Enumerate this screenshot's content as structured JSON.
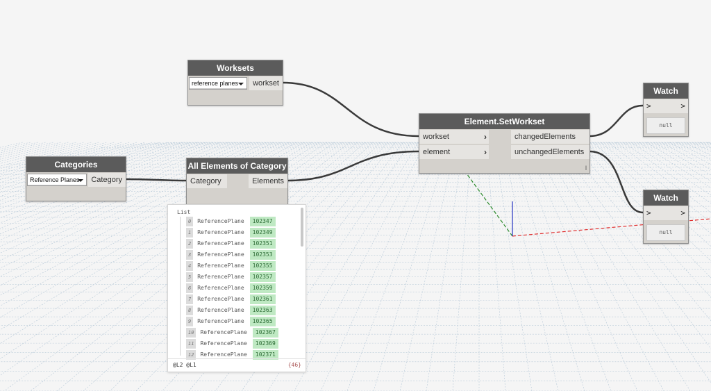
{
  "nodes": {
    "worksets": {
      "title": "Worksets",
      "dropdown_value": "reference planes",
      "output": "workset"
    },
    "categories": {
      "title": "Categories",
      "dropdown_value": "Reference Planes",
      "output": "Category"
    },
    "all_elements": {
      "title": "All Elements of Category",
      "input": "Category",
      "output": "Elements"
    },
    "set_workset": {
      "title": "Element.SetWorkset",
      "inputs": [
        "workset",
        "element"
      ],
      "outputs": [
        "changedElements",
        "unchangedElements"
      ],
      "lacing_mark": "l"
    },
    "watch1": {
      "title": "Watch",
      "in_arrow": ">",
      "out_arrow": ">",
      "value": "null"
    },
    "watch2": {
      "title": "Watch",
      "in_arrow": ">",
      "out_arrow": ">",
      "value": "null"
    }
  },
  "preview": {
    "title": "List",
    "rows": [
      {
        "index": "0",
        "type": "ReferencePlane",
        "id": "102347"
      },
      {
        "index": "1",
        "type": "ReferencePlane",
        "id": "102349"
      },
      {
        "index": "2",
        "type": "ReferencePlane",
        "id": "102351"
      },
      {
        "index": "3",
        "type": "ReferencePlane",
        "id": "102353"
      },
      {
        "index": "4",
        "type": "ReferencePlane",
        "id": "102355"
      },
      {
        "index": "5",
        "type": "ReferencePlane",
        "id": "102357"
      },
      {
        "index": "6",
        "type": "ReferencePlane",
        "id": "102359"
      },
      {
        "index": "7",
        "type": "ReferencePlane",
        "id": "102361"
      },
      {
        "index": "8",
        "type": "ReferencePlane",
        "id": "102363"
      },
      {
        "index": "9",
        "type": "ReferencePlane",
        "id": "102365"
      },
      {
        "index": "10",
        "type": "ReferencePlane",
        "id": "102367"
      },
      {
        "index": "11",
        "type": "ReferencePlane",
        "id": "102369"
      },
      {
        "index": "12",
        "type": "ReferencePlane",
        "id": "102371"
      }
    ],
    "levels": "@L2 @L1",
    "count": "{46}"
  },
  "colors": {
    "node_header": "#5b5b5b",
    "node_body": "#d4d1cc",
    "wire": "#3a3a3a",
    "grid": "#b7c9d8",
    "axis_x": "#e03030",
    "axis_y": "#2a8a2a",
    "axis_z": "#2030c0"
  }
}
